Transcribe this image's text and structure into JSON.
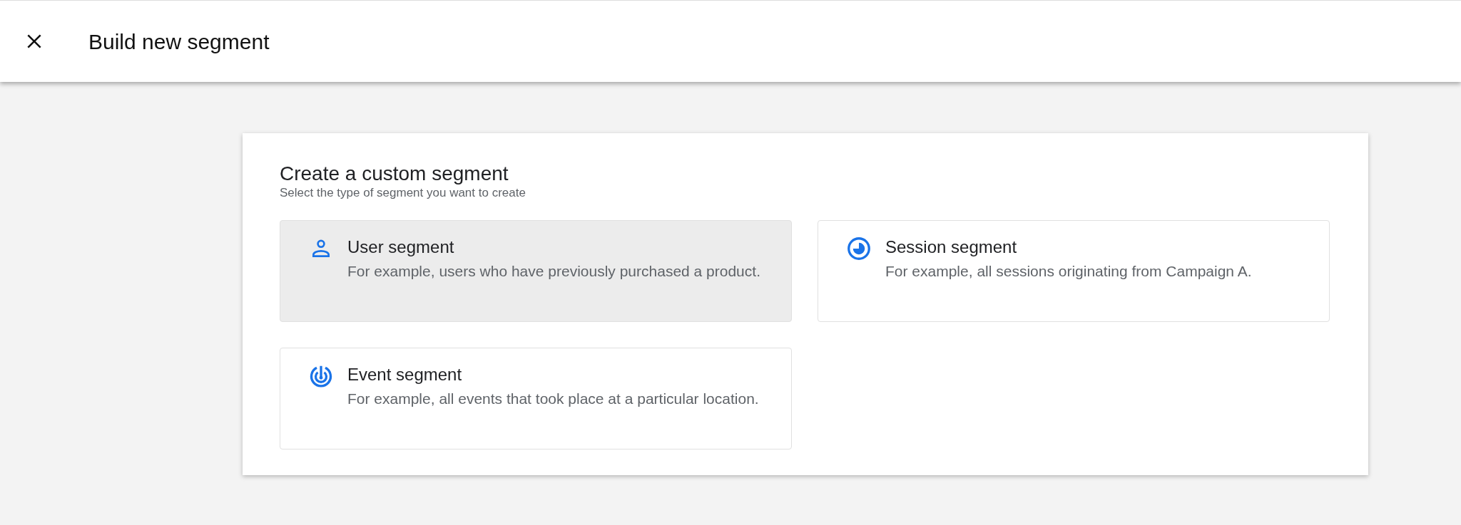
{
  "header": {
    "title": "Build new segment"
  },
  "card": {
    "title": "Create a custom segment",
    "subtitle": "Select the type of segment you want to create",
    "options": [
      {
        "kind": "user",
        "title": "User segment",
        "description": "For example, users who have previously purchased a product.",
        "selected": true
      },
      {
        "kind": "session",
        "title": "Session segment",
        "description": "For example, all sessions originating from Campaign A.",
        "selected": false
      },
      {
        "kind": "event",
        "title": "Event segment",
        "description": "For example, all events that took place at a particular location.",
        "selected": false
      }
    ]
  }
}
